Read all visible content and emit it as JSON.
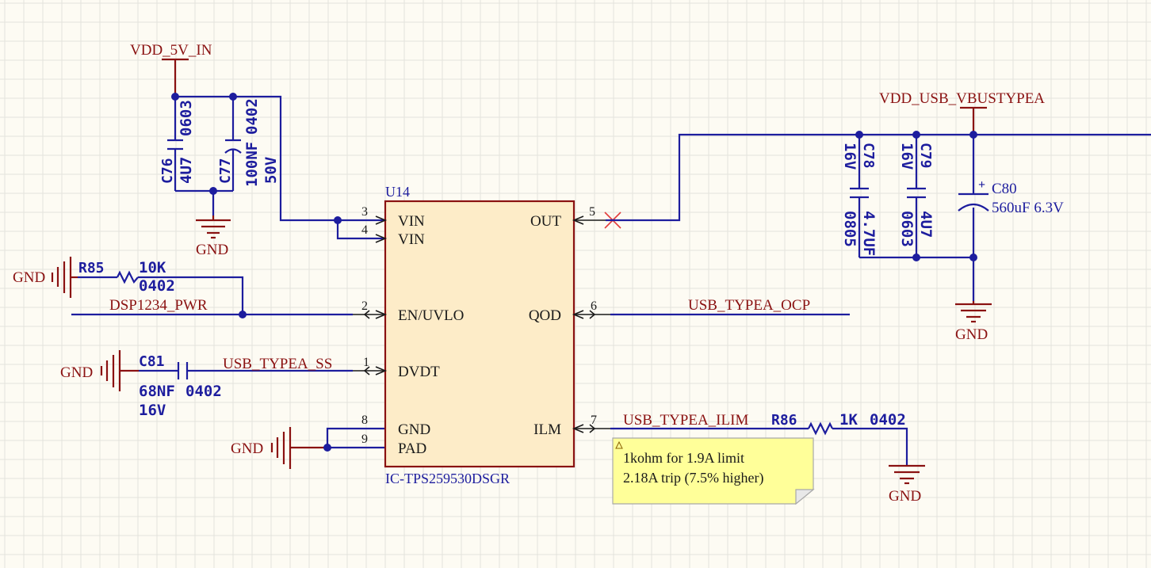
{
  "nets": {
    "vdd_5v_in": "VDD_5V_IN",
    "vdd_usb_vbus": "VDD_USB_VBUSTYPEA",
    "dsp_pwr": "DSP1234_PWR",
    "ocp": "USB_TYPEA_OCP",
    "ss": "USB_TYPEA_SS",
    "ilim": "USB_TYPEA_ILIM",
    "gnd": "GND"
  },
  "ic": {
    "ref": "U14",
    "part": "IC-TPS259530DSGR",
    "pins": [
      {
        "num": "3",
        "name": "VIN"
      },
      {
        "num": "4",
        "name": "VIN"
      },
      {
        "num": "2",
        "name": "EN/UVLO"
      },
      {
        "num": "1",
        "name": "DVDT"
      },
      {
        "num": "8",
        "name": "GND"
      },
      {
        "num": "9",
        "name": "PAD"
      },
      {
        "num": "5",
        "name": "OUT"
      },
      {
        "num": "6",
        "name": "QOD"
      },
      {
        "num": "7",
        "name": "ILM"
      }
    ]
  },
  "components": {
    "c76": {
      "ref": "C76",
      "value": "4U7",
      "size": "0603"
    },
    "c77": {
      "ref": "C77",
      "value": "100NF",
      "size": "0402",
      "voltage": "50V"
    },
    "c78": {
      "ref": "C78",
      "voltage": "16V",
      "size": "0805",
      "value": "4.7UF"
    },
    "c79": {
      "ref": "C79",
      "voltage": "16V",
      "size": "0603",
      "value": "4U7"
    },
    "c80": {
      "ref": "C80",
      "value": "560uF 6.3V"
    },
    "c81": {
      "ref": "C81",
      "value": "68NF",
      "size": "0402",
      "voltage": "16V"
    },
    "r85": {
      "ref": "R85",
      "value": "10K",
      "size": "0402"
    },
    "r86": {
      "ref": "R86",
      "value": "1K",
      "size": "0402"
    }
  },
  "note": {
    "line1": "1kohm for 1.9A limit",
    "line2": "2.18A trip (7.5% higher)"
  },
  "colors": {
    "background": "#fdfbf3",
    "wire": "#1d1d9e",
    "power_net": "#8a1111",
    "ic_body": "#fdecc8",
    "ic_border": "#8a1111",
    "note_fill": "#ffff99",
    "no_connect": "#e23b3b"
  }
}
